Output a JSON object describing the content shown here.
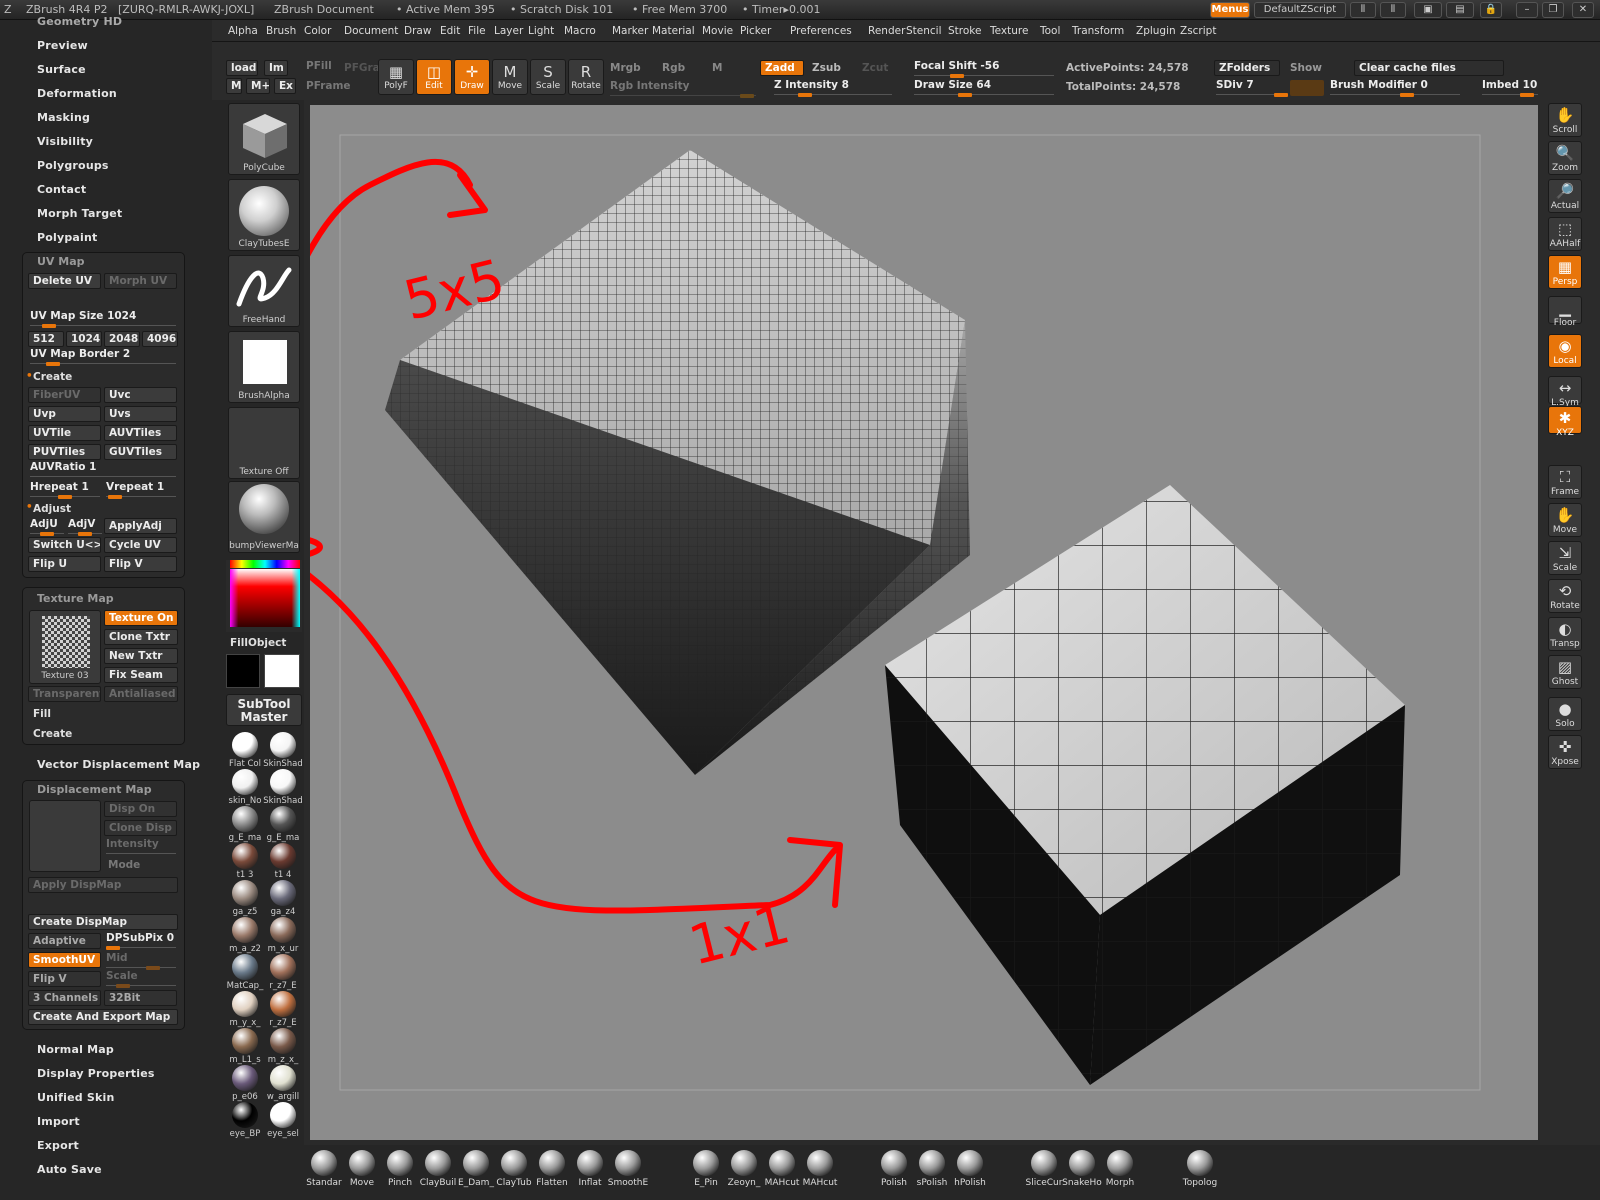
{
  "titlebar": {
    "app": "ZBrush 4R4 P2",
    "serial": "[ZURQ-RMLR-AWKJ-JOXL]",
    "document": "ZBrush Document",
    "active_mem": "• Active Mem 395",
    "scratch_disk": "• Scratch Disk 101",
    "free_mem": "• Free Mem 3700",
    "timer": "• Timer▸0.001",
    "menus_btn": "Menus",
    "zscript_btn": "DefaultZScript"
  },
  "menubar": [
    "Alpha",
    "Brush",
    "Color",
    "Document",
    "Draw",
    "Edit",
    "File",
    "Layer",
    "Light",
    "Macro",
    "Marker",
    "Material",
    "Movie",
    "Picker",
    "Preferences",
    "Render",
    "Stencil",
    "Stroke",
    "Texture",
    "Tool",
    "Transform",
    "Zplugin",
    "Zscript"
  ],
  "leftpanel": {
    "top_cut": "Geometry HD",
    "top_items": [
      "Preview",
      "Surface",
      "Deformation",
      "Masking",
      "Visibility",
      "Polygroups",
      "Contact",
      "Morph Target",
      "Polypaint"
    ],
    "uvmap": {
      "title": "UV Map",
      "delete_uv": "Delete UV",
      "morph_uv": "Morph UV",
      "uv_map_size": "UV Map Size 1024",
      "sizes": [
        "512",
        "1024",
        "2048",
        "4096"
      ],
      "uv_map_border": "UV Map Border 2",
      "create": "Create",
      "buttons": [
        "FiberUV",
        "Uvc",
        "Uvp",
        "Uvs",
        "UVTile",
        "AUVTiles",
        "PUVTiles",
        "GUVTiles"
      ],
      "auvratio": "AUVRatio 1",
      "hrepeat": "Hrepeat 1",
      "vrepeat": "Vrepeat 1",
      "adjust": "Adjust",
      "adju": "AdjU",
      "adjv": "AdjV",
      "applyadj": "ApplyAdj",
      "switch": "Switch U<>V",
      "cycle": "Cycle UV",
      "flipu": "Flip U",
      "flipv": "Flip V"
    },
    "texturemap": {
      "title": "Texture Map",
      "texture_on": "Texture On",
      "clone": "Clone Txtr",
      "new": "New Txtr",
      "fix": "Fix Seam",
      "thumb": "Texture 03",
      "transparent": "Transparent",
      "antialiased": "Antialiased",
      "fill": "Fill",
      "create": "Create"
    },
    "vdm": "Vector Displacement Map",
    "dispmap": {
      "title": "Displacement Map",
      "disp_on": "Disp On",
      "clone_disp": "Clone Disp",
      "intensity": "Intensity",
      "mode": "Mode",
      "apply": "Apply DispMap",
      "create": "Create DispMap",
      "adaptive": "Adaptive",
      "dpsubpix": "DPSubPix 0",
      "smoothuv": "SmoothUV",
      "mid": "Mid",
      "flipv": "Flip V",
      "scale": "Scale",
      "channels": "3 Channels",
      "bit": "32Bit",
      "export": "Create And Export Map"
    },
    "bottom_items": [
      "Normal Map",
      "Display Properties",
      "Unified Skin",
      "Import",
      "Export",
      "Auto Save"
    ]
  },
  "toolbar": {
    "load": "load",
    "im": "Im",
    "m": "M",
    "mplus": "M+",
    "ex": "Ex",
    "pfill": "PFill",
    "pfgra": "PFGra",
    "pframe": "PFrame",
    "tools": [
      {
        "label": "PolyF",
        "icon": "▦",
        "on": false
      },
      {
        "label": "Edit",
        "icon": "◫",
        "on": true
      },
      {
        "label": "Draw",
        "icon": "✛",
        "on": true
      },
      {
        "label": "Move",
        "icon": "M",
        "on": false
      },
      {
        "label": "Scale",
        "icon": "S",
        "on": false
      },
      {
        "label": "Rotate",
        "icon": "R",
        "on": false
      }
    ],
    "mrgb": "Mrgb",
    "rgb": "Rgb",
    "mm": "M",
    "rgb_intensity": "Rgb Intensity",
    "zadd": "Zadd",
    "zsub": "Zsub",
    "zcut": "Zcut",
    "z_intensity": "Z Intensity 8",
    "focal_shift": "Focal Shift -56",
    "draw_size": "Draw Size 64",
    "active_points": "ActivePoints: 24,578",
    "total_points": "TotalPoints: 24,578",
    "zfolders": "ZFolders",
    "show": "Show",
    "clear_cache": "Clear cache files",
    "sdiv": "SDiv 7",
    "brush_modifier": "Brush Modifier 0",
    "imbed": "Imbed 10"
  },
  "shelf": {
    "thumbs": [
      "PolyCube",
      "ClayTubesE",
      "FreeHand",
      "BrushAlpha",
      "Texture Off",
      "bumpViewerMa"
    ],
    "fillobject": "FillObject",
    "subtool_master": "SubTool Master",
    "materials": [
      "Flat Col",
      "SkinShad",
      "skin_No",
      "SkinShad",
      "g_E_ma",
      "g_E_ma",
      "t1 3",
      "t1 4",
      "ga_z5",
      "ga_z4",
      "m_a_z2",
      "m_x_ur",
      "MatCap_",
      "r_z7_E",
      "m_y_x_",
      "r_z7_E",
      "m_L1_s",
      "m_z_x_",
      "p_e06",
      "w_argill",
      "eye_BP",
      "eye_sel"
    ]
  },
  "rightbar": [
    "Scroll",
    "Zoom",
    "Actual",
    "AAHalf",
    "Persp",
    "Floor",
    "Local",
    "L.Sym",
    "XYZ",
    "Frame",
    "Move",
    "Scale",
    "Rotate",
    "Transp",
    "Ghost",
    "Solo",
    "Xpose"
  ],
  "bottombar": [
    "Standar",
    "Move",
    "Pinch",
    "ClayBuil",
    "E_Dam_",
    "ClayTub",
    "Flatten",
    "Inflat",
    "SmoothE",
    "E_Pin",
    "Zeoyn_",
    "MAHcut",
    "MAHcut",
    "Polish",
    "sPolish",
    "hPolish",
    "SliceCur",
    "SnakeHo",
    "Morph",
    "Topolog"
  ],
  "annotations": {
    "top": "5x5",
    "bottom": "1x1"
  },
  "colors": {
    "accent": "#e8750a",
    "annotation": "#ff0000",
    "canvas": "#8c8c8c"
  }
}
